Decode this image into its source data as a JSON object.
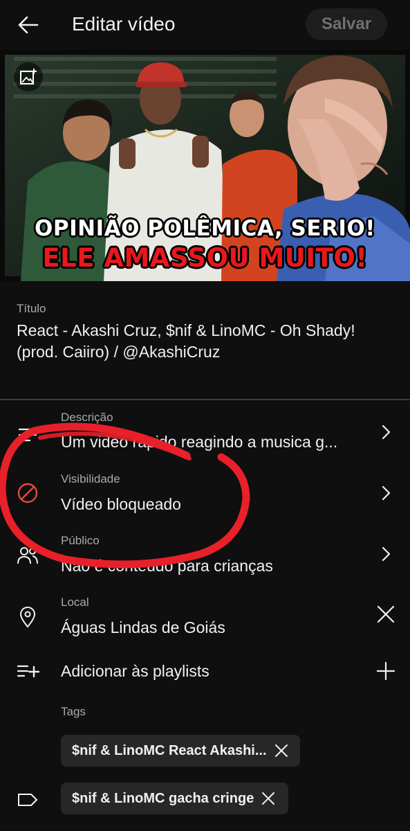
{
  "header": {
    "title": "Editar vídeo",
    "save_label": "Salvar"
  },
  "thumbnail": {
    "caption_line1": "OPINIÃO POLÊMICA, SERIO!",
    "caption_line2": "ELE AMASSOU MUITO!"
  },
  "title_field": {
    "label": "Título",
    "value": "React - Akashi Cruz, $nif & LinoMC  - Oh Shady! (prod. Caiiro) / @AkashiCruz"
  },
  "settings": {
    "description": {
      "label": "Descrição",
      "value": "Um video rapido reagindo a musica g...",
      "icon": "description-lines-icon"
    },
    "visibility": {
      "label": "Visibilidade",
      "value": "Vídeo bloqueado",
      "icon": "blocked-icon",
      "icon_color": "#e8483f"
    },
    "audience": {
      "label": "Público",
      "value": "Não é conteúdo para crianças",
      "icon": "audience-icon"
    },
    "location": {
      "label": "Local",
      "value": "Águas Lindas de Goiás",
      "icon": "location-pin-icon"
    },
    "playlists": {
      "value": "Adicionar às playlists",
      "icon": "add-playlist-icon"
    }
  },
  "tags": {
    "label": "Tags",
    "items": [
      "$nif & LinoMC React Akashi...",
      "$nif & LinoMC gacha cringe"
    ]
  },
  "colors": {
    "background": "#0f0f0f",
    "annotation_red": "#e8202a",
    "chip_background": "#272727"
  }
}
